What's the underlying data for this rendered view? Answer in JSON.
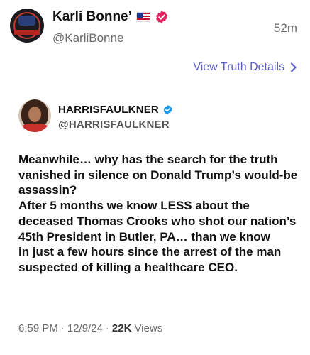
{
  "post": {
    "author_name": "Karli Bonne’",
    "author_handle": "@KarliBonne",
    "time_ago": "52m",
    "view_details_label": "View Truth Details"
  },
  "quoted": {
    "name": "HARRISFAULKNER",
    "handle": "@HARRISFAULKNER",
    "body": "Meanwhile… why has the search for the truth vanished in silence on Donald Trump’s would-be assassin?\n   After 5 months we know LESS about the deceased Thomas Crooks who shot our nation’s 45th President in Butler, PA… than we know\nin just a few hours since the arrest of the man suspected of killing a healthcare CEO.",
    "time": "6:59 PM",
    "date": "12/9/24",
    "separator": "·",
    "views_count": "22K",
    "views_label": "Views"
  },
  "icons": {
    "flag": "us-flag-icon",
    "author_badge": "verified-badge-icon",
    "quoted_badge": "verified-badge-icon",
    "details_chevron": "chevron-right-icon"
  },
  "colors": {
    "link": "#5b5fc7",
    "author_badge": "#e0245e",
    "quoted_badge": "#1d9bf0"
  }
}
